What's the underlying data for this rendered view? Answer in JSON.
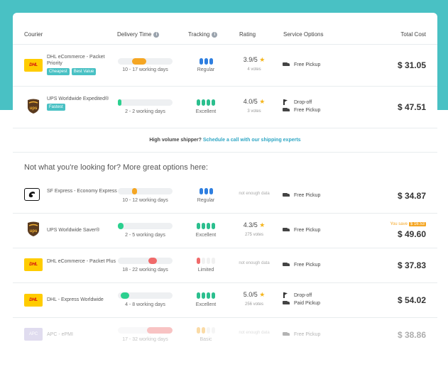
{
  "headers": {
    "courier": "Courier",
    "delivery_time": "Delivery Time",
    "tracking": "Tracking",
    "rating": "Rating",
    "service_options": "Service Options",
    "total_cost": "Total Cost"
  },
  "top_results": [
    {
      "courier": "DHL eCommerce - Packet Priority",
      "logo": "DHL",
      "badges": [
        "Cheapest",
        "Best Value"
      ],
      "delivery_days": "10 - 17 working days",
      "tracking": "Regular",
      "rating": "3.9/5",
      "votes": "4 votes",
      "services": [
        {
          "icon": "truck-icon",
          "label": "Free Pickup"
        }
      ],
      "cost": "$ 31.05"
    },
    {
      "courier": "UPS Worldwide Expedited®",
      "logo": "ups",
      "badges": [
        "Fastest"
      ],
      "delivery_days": "2 - 2 working days",
      "tracking": "Excellent",
      "rating": "4.0/5",
      "votes": "3 votes",
      "services": [
        {
          "icon": "drop-off-icon",
          "label": "Drop-off"
        },
        {
          "icon": "truck-icon",
          "label": "Free Pickup"
        }
      ],
      "cost": "$ 47.51"
    }
  ],
  "high_volume": {
    "text": "High volume shipper?",
    "link": "Schedule a call with our shipping experts"
  },
  "more_options_title": "Not what you're looking for? More great options here:",
  "more_results": [
    {
      "courier": "SF Express - Economy Express",
      "logo": "SF",
      "delivery_days": "10 - 12 working days",
      "tracking": "Regular",
      "rating_text": "not enough data",
      "services": [
        {
          "icon": "truck-icon",
          "label": "Free Pickup"
        }
      ],
      "cost": "$ 34.87"
    },
    {
      "courier": "UPS Worldwide Saver®",
      "logo": "ups",
      "delivery_days": "2 - 5 working days",
      "tracking": "Excellent",
      "rating": "4.3/5",
      "votes": "275 votes",
      "services": [
        {
          "icon": "truck-icon",
          "label": "Free Pickup"
        }
      ],
      "save_text": "You save",
      "save_amount": "$ 16.53",
      "cost": "$ 49.60"
    },
    {
      "courier": "DHL eCommerce - Packet Plus",
      "logo": "DHL",
      "delivery_days": "18 - 22 working days",
      "tracking": "Limited",
      "rating_text": "not enough data",
      "services": [
        {
          "icon": "truck-icon",
          "label": "Free Pickup"
        }
      ],
      "cost": "$ 37.83"
    },
    {
      "courier": "DHL - Express Worldwide",
      "logo": "DHL",
      "delivery_days": "4 - 8 working days",
      "tracking": "Excellent",
      "rating": "5.0/5",
      "votes": "256 votes",
      "services": [
        {
          "icon": "drop-off-icon",
          "label": "Drop-off"
        },
        {
          "icon": "truck-icon",
          "label": "Paid Pickup"
        }
      ],
      "cost": "$ 54.02"
    },
    {
      "courier": "APC - ePMI",
      "logo": "APC",
      "delivery_days": "17 - 32 working days",
      "tracking": "Basic",
      "rating_text": "not enough data",
      "services": [
        {
          "icon": "truck-icon",
          "label": "Free Pickup"
        }
      ],
      "cost": "$ 38.86"
    }
  ],
  "colors": {
    "accent": "#49c1c4",
    "tracking_blue": "#2f7fe0",
    "tracking_green": "#2bbf8e",
    "bar_orange": "#f5a623",
    "bar_green": "#2bd08f",
    "bar_red": "#f06a6a",
    "save_orange": "#f5a623"
  }
}
